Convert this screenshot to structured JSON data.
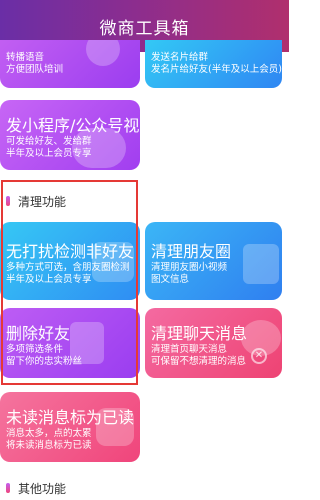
{
  "header": {
    "title": "微商工具箱"
  },
  "cards_top": [
    {
      "line1": "转播语音",
      "line2": "方便团队培训"
    },
    {
      "line1": "发送名片给群",
      "line2": "发名片给好友(半年及以上会员)"
    }
  ],
  "mini_program_card": {
    "title": "发小程序/公众号视...",
    "lines": [
      "可发给好友、发给群",
      "半年及以上会员专享"
    ]
  },
  "section_cleanup": {
    "label": "清理功能"
  },
  "cleanup_cards": [
    {
      "title": "无打扰检测非好友",
      "lines": [
        "多种方式可选，含朋友圈检测",
        "半年及以上会员专享"
      ]
    },
    {
      "title": "清理朋友圈",
      "lines": [
        "清理朋友圈小视频",
        "图文信息"
      ]
    },
    {
      "title": "删除好友",
      "lines": [
        "多项筛选条件",
        "留下你的忠实粉丝"
      ]
    },
    {
      "title": "清理聊天消息",
      "lines": [
        "清理首页聊天消息",
        "可保留不想清理的消息"
      ]
    },
    {
      "title": "未读消息标为已读",
      "lines": [
        "消息太多，点的太累",
        "将未读消息标为已读"
      ]
    }
  ],
  "section_other": {
    "label": "其他功能"
  },
  "colors": {
    "header_start": "#6a2ea6",
    "header_end": "#b02f6d",
    "purple": "#9b3df0",
    "blue": "#2f9df3",
    "pink": "#f0457b",
    "highlight": "#e53935"
  }
}
